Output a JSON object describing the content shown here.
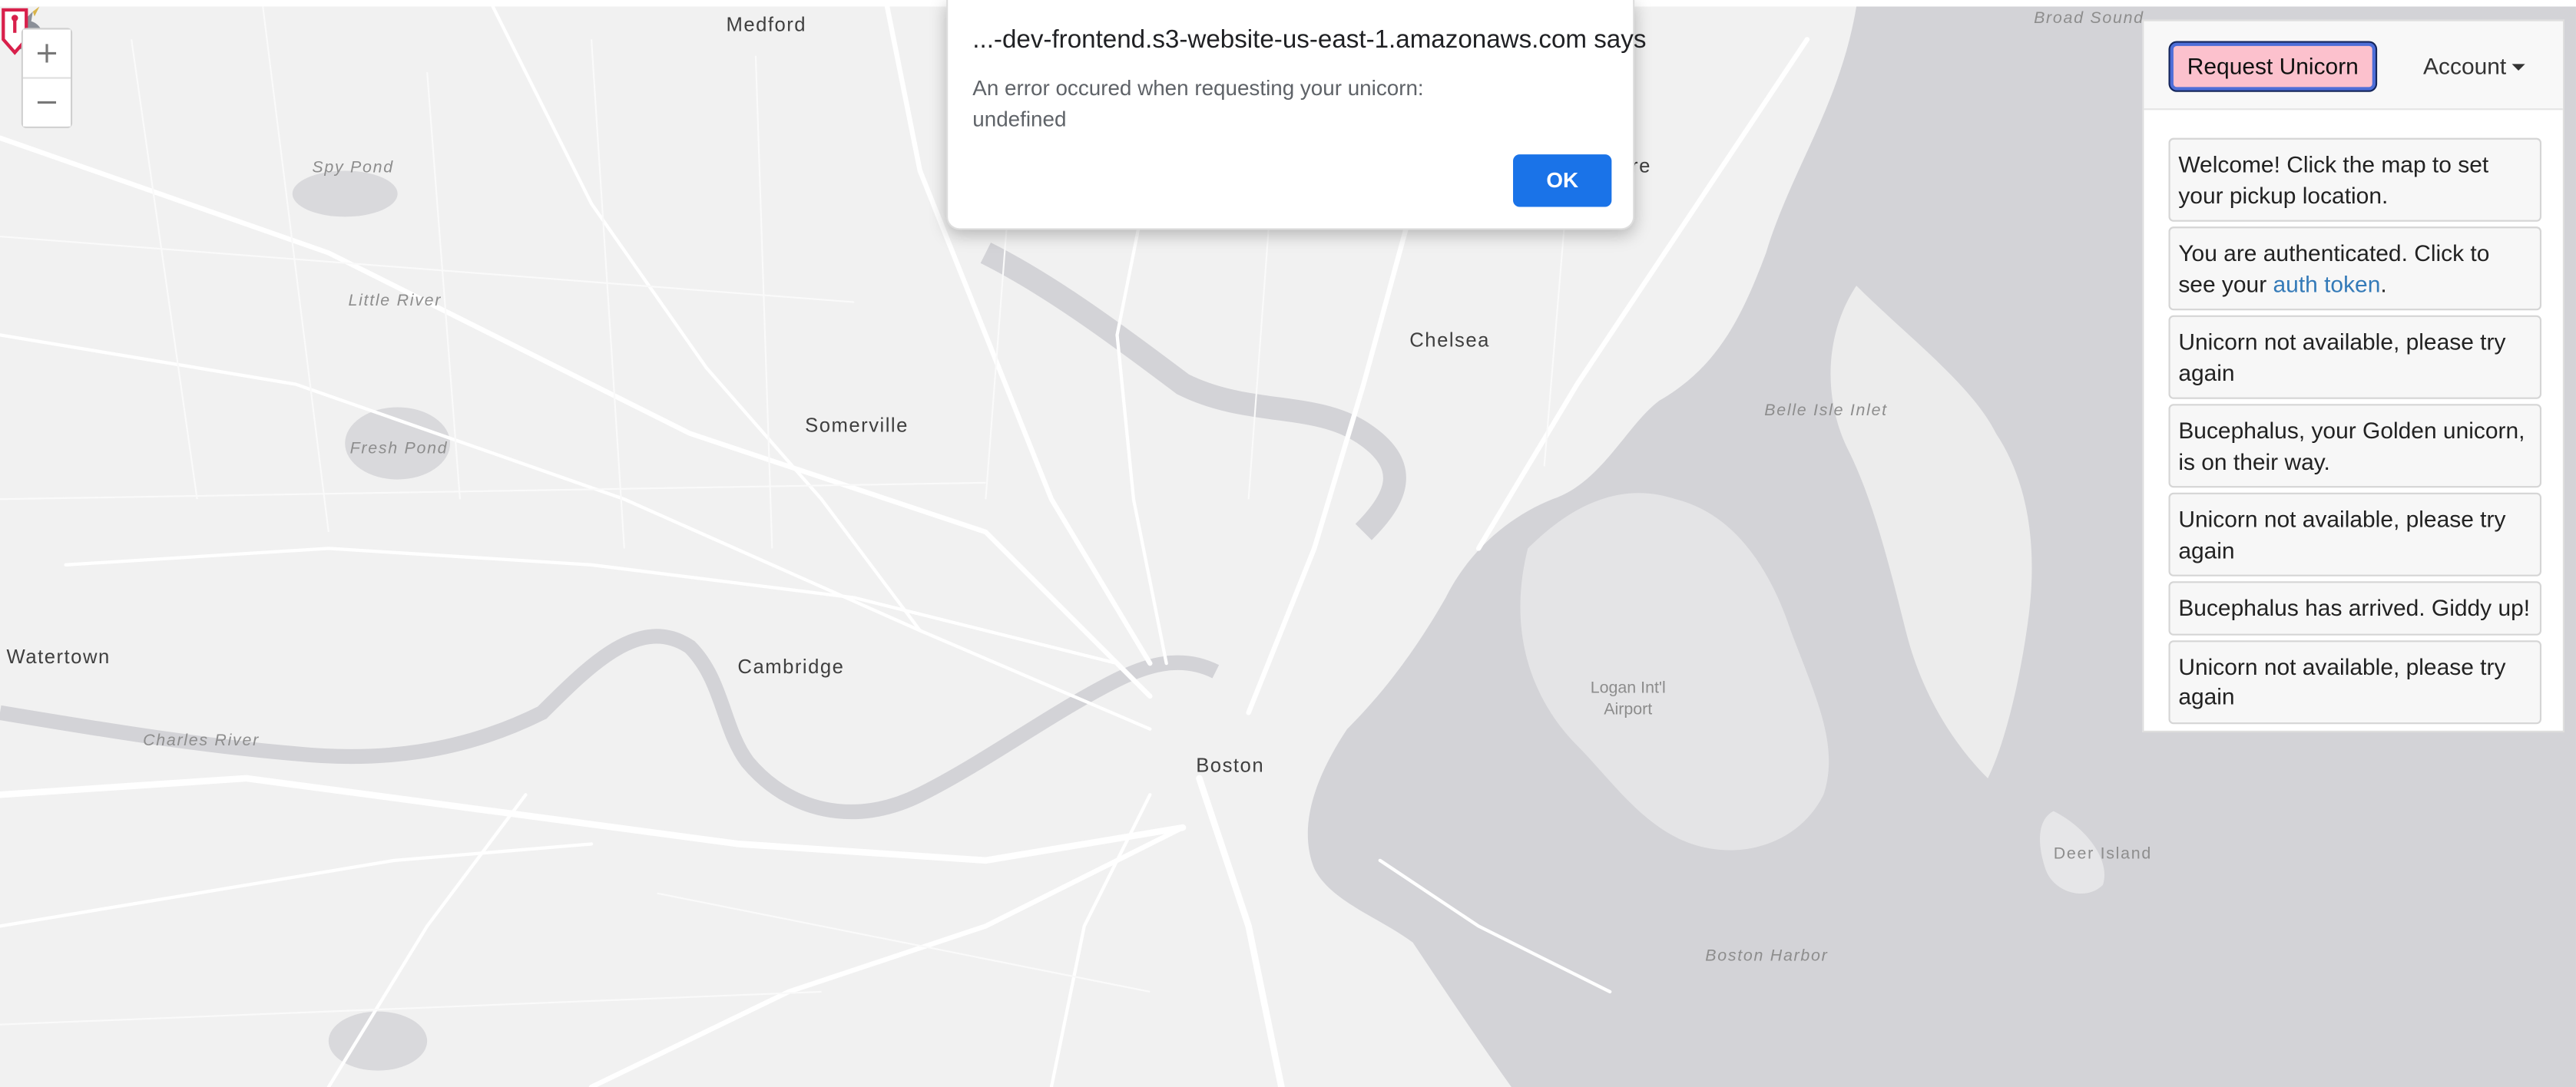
{
  "dialog": {
    "title": "...-dev-frontend.s3-website-us-east-1.amazonaws.com says",
    "message": "An error occured when requesting your unicorn: undefined",
    "ok_label": "OK"
  },
  "panel": {
    "request_label": "Request Unicorn",
    "account_label": "Account",
    "updates": [
      {
        "text": "Welcome! Click the map to set your pickup location."
      },
      {
        "text": "You are authenticated. Click to see your ",
        "link": "auth token",
        "suffix": "."
      },
      {
        "text": "Unicorn not available, please try again"
      },
      {
        "text": "Bucephalus, your Golden unicorn, is on their way."
      },
      {
        "text": "Unicorn not available, please try again"
      },
      {
        "text": "Bucephalus has arrived. Giddy up!"
      },
      {
        "text": "Unicorn not available, please try again"
      }
    ]
  },
  "zoom": {
    "in_label": "+",
    "out_label": "−"
  },
  "map": {
    "places": {
      "medford": "Medford",
      "somerville": "Somerville",
      "chelsea": "Chelsea",
      "cambridge": "Cambridge",
      "watertown": "Watertown",
      "boston": "Boston",
      "re_fragment": "re"
    },
    "water": {
      "broad_sound": "Broad Sound",
      "spy_pond": "Spy Pond",
      "little_river": "Little River",
      "fresh_pond": "Fresh Pond",
      "belle_isle_inlet": "Belle Isle Inlet",
      "charles_river": "Charles River",
      "boston_harbor": "Boston Harbor",
      "deer_island": "Deer Island"
    },
    "airport_label": "Logan Int'l Airport"
  },
  "colors": {
    "land": "#f1f1f1",
    "water": "#d3d3d7",
    "road": "#ffffff",
    "pin": "#d8204b",
    "request_button": "#fcc1cd",
    "dialog_button": "#1a73e8"
  }
}
